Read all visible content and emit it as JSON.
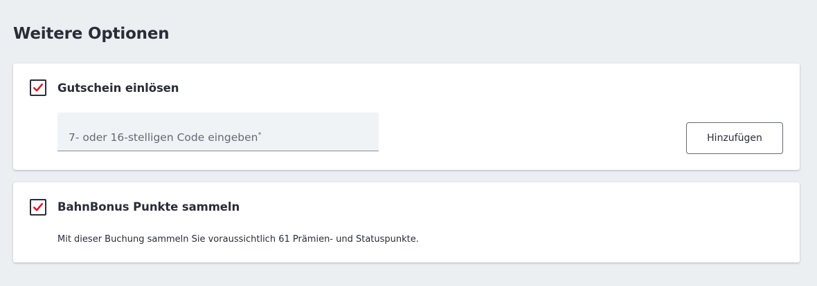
{
  "section": {
    "title": "Weitere Optionen"
  },
  "voucher": {
    "checked": true,
    "label": "Gutschein einlösen",
    "code_placeholder": "7- oder 16-stelligen Code eingeben",
    "required_marker": "*",
    "add_button_label": "Hinzufügen"
  },
  "bonus": {
    "checked": true,
    "label": "BahnBonus Punkte sammeln",
    "description": "Mit dieser Buchung sammeln Sie voraussichtlich 61 Prämien- und Statuspunkte."
  },
  "colors": {
    "background": "#eceff2",
    "card": "#ffffff",
    "text": "#282d37",
    "checkmark": "#ec0016",
    "field_background": "#f0f3f5"
  },
  "icons": {
    "checkbox_checked": "checkmark-icon"
  }
}
